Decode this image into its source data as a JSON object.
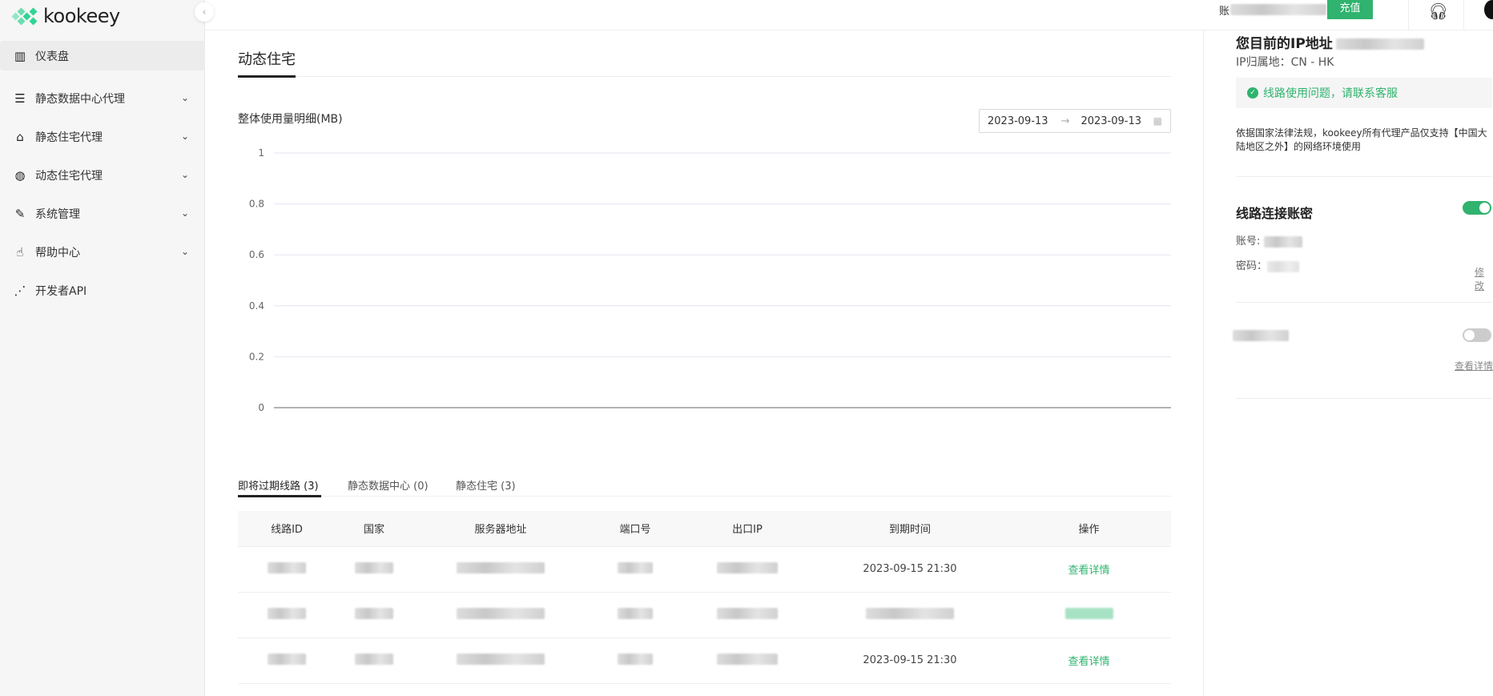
{
  "brand": {
    "name": "kookeey",
    "accent": "#2fb36e"
  },
  "sidebar": {
    "items": [
      {
        "label": "仪表盘",
        "icon": "dashboard-chart-icon",
        "active": true
      },
      {
        "label": "静态数据中心代理",
        "icon": "server-list-icon",
        "expandable": true
      },
      {
        "label": "静态住宅代理",
        "icon": "home-icon",
        "expandable": true
      },
      {
        "label": "动态住宅代理",
        "icon": "globe-icon",
        "expandable": true
      },
      {
        "label": "系统管理",
        "icon": "edit-icon",
        "expandable": true
      },
      {
        "label": "帮助中心",
        "icon": "hand-pointer-icon",
        "expandable": true
      },
      {
        "label": "开发者API",
        "icon": "share-nodes-icon"
      }
    ]
  },
  "topbar": {
    "balance_prefix": "账",
    "recharge_label": "充值"
  },
  "main": {
    "page_tab": "动态住宅",
    "chart_title": "整体使用量明细(MB)",
    "date_start": "2023-09-13",
    "date_sep": "→",
    "date_end": "2023-09-13",
    "tabs": [
      {
        "label": "即将过期线路 (3)",
        "active": true
      },
      {
        "label": "静态数据中心 (0)"
      },
      {
        "label": "静态住宅 (3)"
      }
    ],
    "table": {
      "columns": [
        "线路ID",
        "国家",
        "服务器地址",
        "端口号",
        "出口IP",
        "到期时间",
        "操作"
      ],
      "rows": [
        {
          "expiry": "2023-09-15 21:30",
          "action": "查看详情"
        },
        {
          "expiry": "",
          "action": ""
        },
        {
          "expiry": "2023-09-15 21:30",
          "action": "查看详情"
        }
      ]
    }
  },
  "chart_data": {
    "type": "line",
    "title": "整体使用量明细(MB)",
    "yticks": [
      "1",
      "0.8",
      "0.6",
      "0.4",
      "0.2",
      "0"
    ],
    "ylim": [
      0,
      1
    ],
    "grid": true,
    "series": []
  },
  "right": {
    "ip_title": "您目前的IP地址",
    "ip_location": "IP归属地：CN - HK",
    "notice": "线路使用问题，请联系客服",
    "legal_note": "依据国家法律法规，kookeey所有代理产品仅支持【中国大陆地区之外】的网络环境使用",
    "credentials_title": "线路连接账密",
    "credentials_enabled": true,
    "account_label": "账号: ",
    "password_label": "密码：",
    "edit_label": "修改",
    "second_toggle_enabled": false,
    "details_label": "查看详情"
  }
}
